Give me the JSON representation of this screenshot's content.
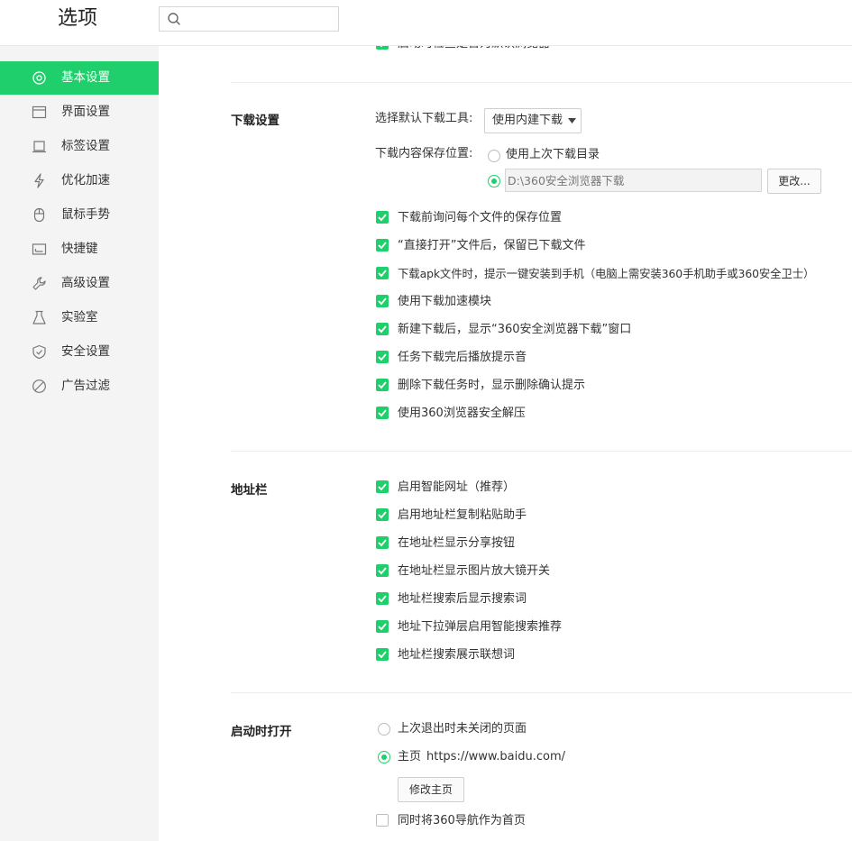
{
  "header": {
    "title": "选项",
    "search_placeholder": ""
  },
  "sidebar": {
    "items": [
      {
        "label": "基本设置",
        "icon": "gear-icon"
      },
      {
        "label": "界面设置",
        "icon": "window-icon"
      },
      {
        "label": "标签设置",
        "icon": "tab-icon"
      },
      {
        "label": "优化加速",
        "icon": "lightning-icon"
      },
      {
        "label": "鼠标手势",
        "icon": "mouse-icon"
      },
      {
        "label": "快捷键",
        "icon": "keyboard-icon"
      },
      {
        "label": "高级设置",
        "icon": "wrench-icon"
      },
      {
        "label": "实验室",
        "icon": "flask-icon"
      },
      {
        "label": "安全设置",
        "icon": "shield-icon"
      },
      {
        "label": "广告过滤",
        "icon": "block-icon"
      }
    ],
    "active_index": 0
  },
  "top_partial": {
    "label": "启动时检查是否为默认浏览器",
    "checked": true
  },
  "download": {
    "title": "下载设置",
    "tool_label": "选择默认下载工具:",
    "tool_value": "使用内建下载",
    "location_label": "下载内容保存位置:",
    "option_last_dir": "使用上次下载目录",
    "path_value": "D:\\360安全浏览器下载",
    "change_button": "更改...",
    "checks": [
      "下载前询问每个文件的保存位置",
      "“直接打开”文件后，保留已下载文件",
      "下载apk文件时，提示一键安装到手机（电脑上需安装360手机助手或360安全卫士）",
      "使用下载加速模块",
      "新建下载后，显示“360安全浏览器下载”窗口",
      "任务下载完后播放提示音",
      "删除下载任务时，显示删除确认提示",
      "使用360浏览器安全解压"
    ]
  },
  "addressbar": {
    "title": "地址栏",
    "checks": [
      "启用智能网址（推荐）",
      "启用地址栏复制粘贴助手",
      "在地址栏显示分享按钮",
      "在地址栏显示图片放大镜开关",
      "地址栏搜索后显示搜索词",
      "地址下拉弹层启用智能搜索推荐",
      "地址栏搜索展示联想词"
    ]
  },
  "startup": {
    "title": "启动时打开",
    "option_last_pages": "上次退出时未关闭的页面",
    "option_home": "主页",
    "home_url": "https://www.baidu.com/",
    "modify_button": "修改主页",
    "nav_home_check": "同时将360导航作为首页"
  },
  "colors": {
    "accent": "#1fcf6b",
    "sidebar_bg": "#f4f4f4"
  }
}
